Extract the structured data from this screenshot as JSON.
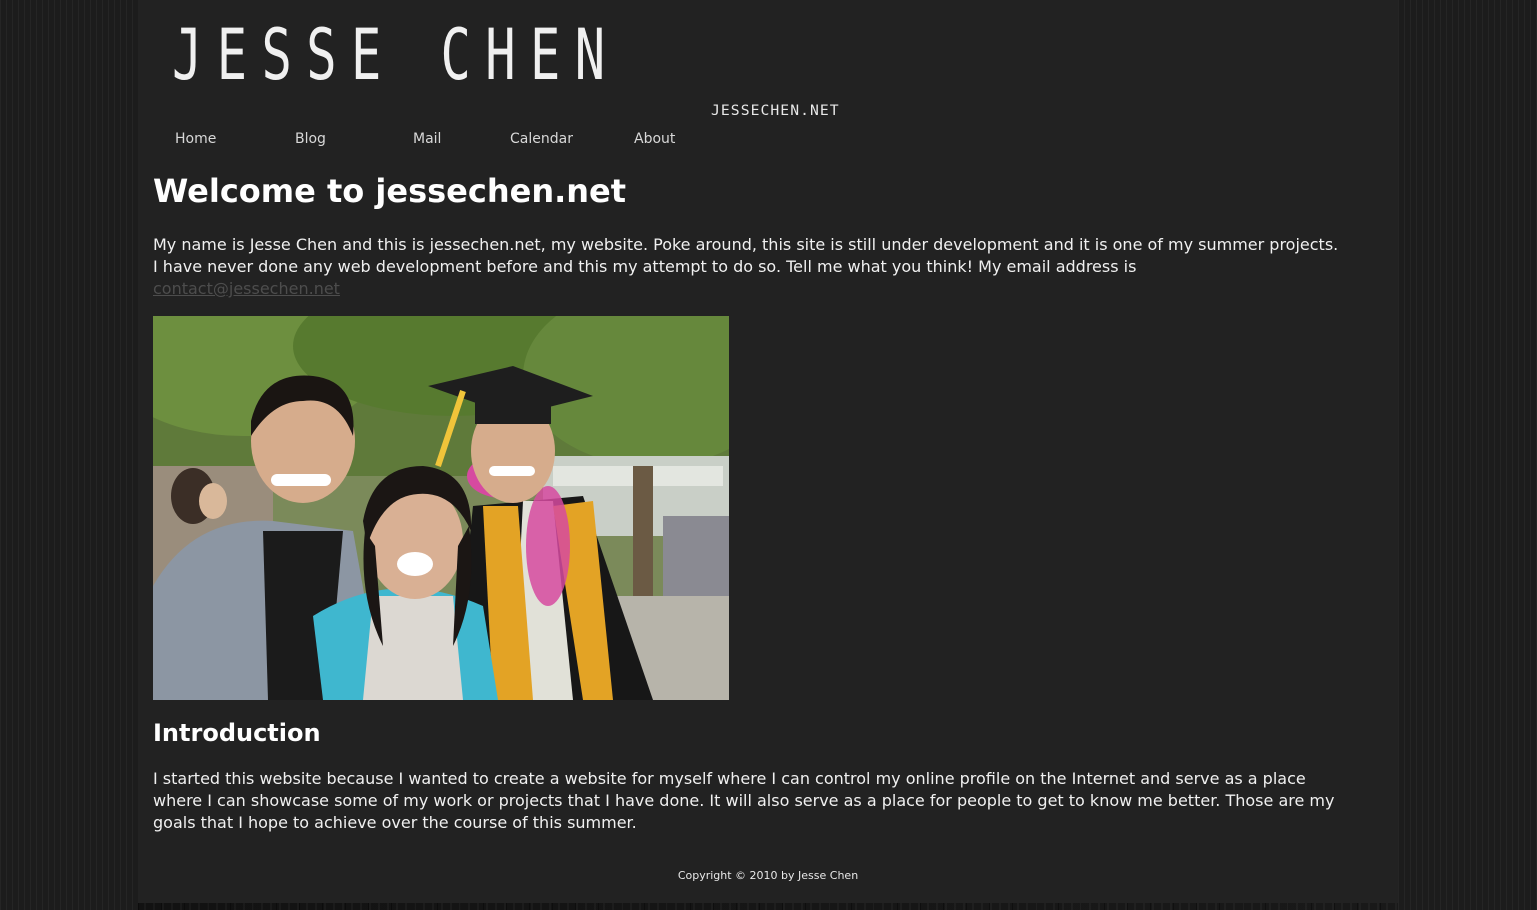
{
  "site": {
    "logo_title": "JESSE CHEN",
    "logo_sub": "JESSECHEN.NET"
  },
  "nav": {
    "items": [
      {
        "label": "Home"
      },
      {
        "label": "Blog"
      },
      {
        "label": "Mail"
      },
      {
        "label": "Calendar"
      },
      {
        "label": "About"
      }
    ]
  },
  "main": {
    "heading": "Welcome to jessechen.net",
    "intro_text": "My name is Jesse Chen and this is jessechen.net, my website. Poke around, this site is still under development and it is one of my summer projects. I have never done any web development before and this my attempt to do so. Tell me what you think! My email address is",
    "email": "contact@jessechen.net",
    "photo": {
      "description_icon": "graduation-photo"
    },
    "intro_heading": "Introduction",
    "intro_body": "I started this website because I wanted to create a website for myself where I can control my online profile on the Internet and serve as a place where I can showcase some of my work or projects that I have done. It will also serve as a place for people to get to know me better. Those are my goals that I hope to achieve over the course of this summer."
  },
  "footer": {
    "copyright": "Copyright © 2010 by Jesse Chen"
  },
  "colors": {
    "page_bg": "#222222",
    "outer_bg": "#141414",
    "link": "#4d4d4d",
    "text": "#f0f0f0"
  }
}
